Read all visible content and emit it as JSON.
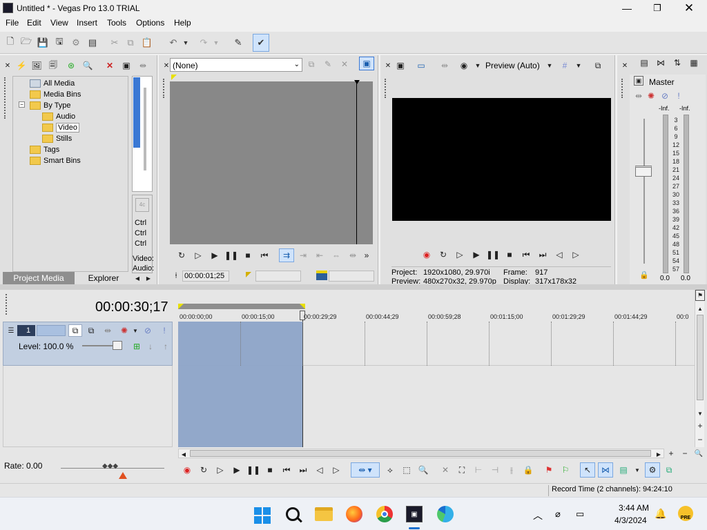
{
  "window": {
    "title": "Untitled * - Vegas Pro 13.0 TRIAL"
  },
  "menu": [
    "File",
    "Edit",
    "View",
    "Insert",
    "Tools",
    "Options",
    "Help"
  ],
  "tree": {
    "items": [
      {
        "label": "All Media"
      },
      {
        "label": "Media Bins"
      },
      {
        "label": "By Type"
      },
      {
        "label": "Audio"
      },
      {
        "label": "Video"
      },
      {
        "label": "Stills"
      },
      {
        "label": "Tags"
      },
      {
        "label": "Smart Bins"
      }
    ],
    "expand_toggle": "−"
  },
  "properties": {
    "ctrl1": "Ctrl",
    "ctrl2": "Ctrl",
    "ctrl3": "Ctrl",
    "video": "Video:",
    "audio": "Audio:"
  },
  "tabs": {
    "project_media": "Project Media",
    "explorer": "Explorer"
  },
  "trimmer": {
    "dropdown_value": "(None)",
    "time": "00:00:01;25"
  },
  "preview": {
    "quality_label": "Preview (Auto)",
    "project_label": "Project:",
    "project_value": "1920x1080, 29.970i",
    "preview_label": "Preview:",
    "preview_value": "480x270x32, 29.970p",
    "frame_label": "Frame:",
    "frame_value": "917",
    "display_label": "Display:",
    "display_value": "317x178x32"
  },
  "mixer": {
    "master_label": "Master",
    "peak_left": "-Inf.",
    "peak_right": "-Inf.",
    "scale": [
      "3",
      "6",
      "9",
      "12",
      "15",
      "18",
      "21",
      "24",
      "27",
      "30",
      "33",
      "36",
      "39",
      "42",
      "45",
      "48",
      "51",
      "54",
      "57"
    ],
    "readout_left": "0.0",
    "readout_right": "0.0"
  },
  "timeline": {
    "timecode": "00:00:30;17",
    "track_number": "1",
    "level_label": "Level: 100.0 %",
    "rate_label": "Rate: 0.00",
    "ruler": [
      "00:00:00;00",
      "00:00:15;00",
      "00:00:29;29",
      "00:00:44;29",
      "00:00:59;28",
      "00:01:15;00",
      "00:01:29;29",
      "00:01:44;29",
      "00:0"
    ],
    "selection_fraction_of_view": 0.24
  },
  "status": {
    "record_time": "Record Time (2 channels): 94:24:10"
  },
  "taskbar": {
    "time": "3:44 AM",
    "date": "4/3/2024",
    "badge": "PRE"
  },
  "colors": {
    "accent_blue": "#3a78d4",
    "selection_blue": "#8da4c8",
    "folder_yellow": "#f2c94c",
    "record_red": "#d22"
  },
  "icons": [
    "new-icon",
    "open-icon",
    "save-icon",
    "undo-icon",
    "redo-icon",
    "cut-icon",
    "copy-icon",
    "paste-icon",
    "delete-icon",
    "play-icon",
    "stop-icon",
    "record-icon",
    "loop-icon",
    "windows-start-icon",
    "search-icon",
    "folder-icon",
    "firefox-icon",
    "chrome-icon",
    "vegas-icon",
    "edge-icon",
    "tray-up-icon",
    "wifi-off-icon",
    "display-icon",
    "bell-icon"
  ]
}
